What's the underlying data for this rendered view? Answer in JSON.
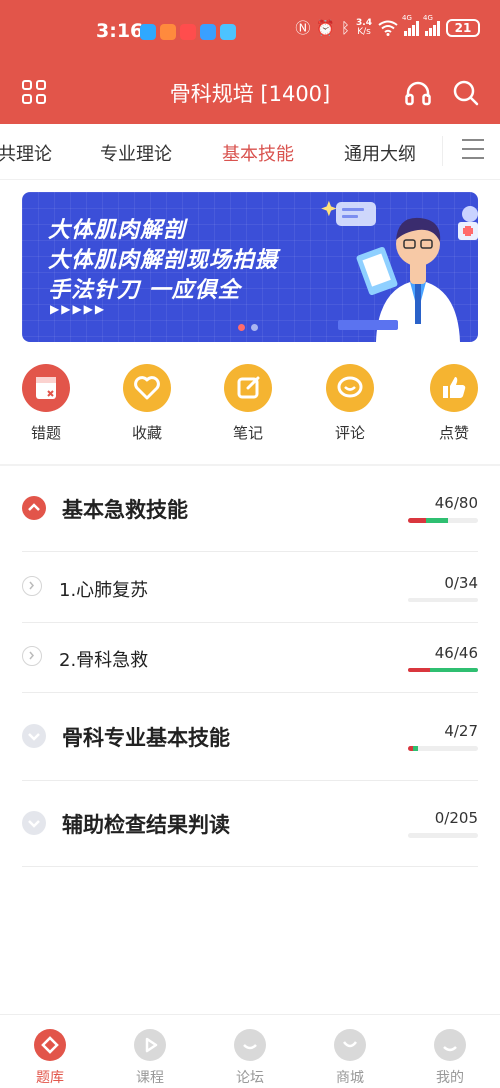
{
  "status_bar": {
    "time": "3:16",
    "speed_top": "3.4",
    "speed_bottom": "K/s",
    "net1": "4G",
    "net2": "4G",
    "battery": "21"
  },
  "header": {
    "title": "骨科规培 [1400]"
  },
  "tabs": [
    {
      "label": "共理论"
    },
    {
      "label": "专业理论"
    },
    {
      "label": "基本技能",
      "active": true
    },
    {
      "label": "通用大纲"
    }
  ],
  "banner": {
    "line1": "大体肌肉解剖",
    "line2": "大体肌肉解剖现场拍摄",
    "line3": "手法针刀  一应俱全",
    "arrows": "▶▶▶▶▶"
  },
  "actions": [
    {
      "label": "错题",
      "icon": "wrong-book-icon",
      "color": "#e2554a"
    },
    {
      "label": "收藏",
      "icon": "heart-icon",
      "color": "#f5b431"
    },
    {
      "label": "笔记",
      "icon": "note-icon",
      "color": "#f5b431"
    },
    {
      "label": "评论",
      "icon": "comment-icon",
      "color": "#f5b431"
    },
    {
      "label": "点赞",
      "icon": "thumbs-up-icon",
      "color": "#f5b431"
    }
  ],
  "sections": [
    {
      "title": "基本急救技能",
      "count": "46/80",
      "progress_red": 0.25,
      "progress_green": 0.32,
      "expanded": true,
      "children": [
        {
          "title": "1.心肺复苏",
          "count": "0/34",
          "progress_red": 0,
          "progress_green": 0
        },
        {
          "title": "2.骨科急救",
          "count": "46/46",
          "progress_red": 0.32,
          "progress_green": 0.68
        }
      ]
    },
    {
      "title": "骨科专业基本技能",
      "count": "4/27",
      "progress_red": 0.07,
      "progress_green": 0.07,
      "expanded": false
    },
    {
      "title": "辅助检查结果判读",
      "count": "0/205",
      "progress_red": 0,
      "progress_green": 0,
      "expanded": false
    }
  ],
  "bottom_nav": [
    {
      "label": "题库",
      "active": true
    },
    {
      "label": "课程"
    },
    {
      "label": "论坛"
    },
    {
      "label": "商城"
    },
    {
      "label": "我的"
    }
  ],
  "colors": {
    "brand": "#e2554a",
    "progress_red": "#d9363e",
    "progress_green": "#2fbf71",
    "banner_bg": "#3b4fd8"
  }
}
